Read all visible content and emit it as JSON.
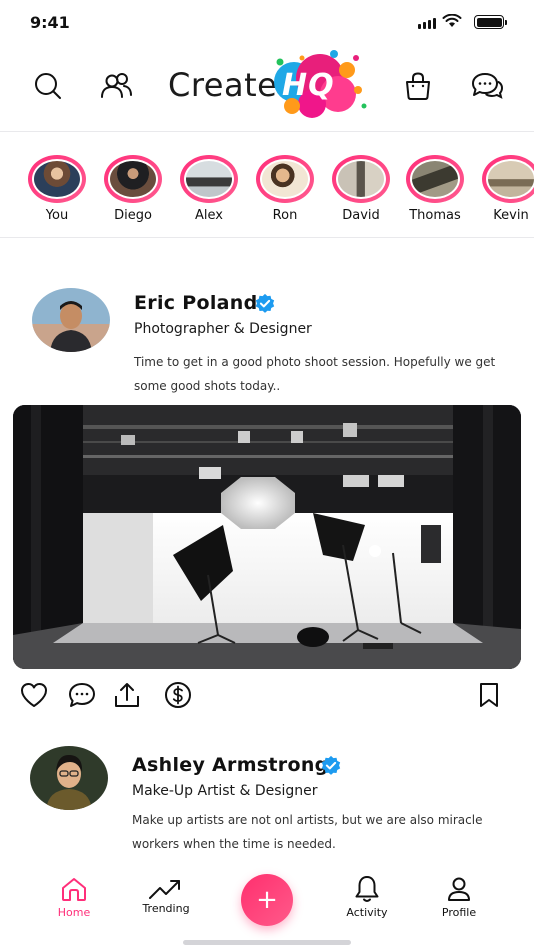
{
  "status_bar": {
    "time": "9:41"
  },
  "header": {
    "logo_text": "Create",
    "logo_badge": "HQ",
    "icons": [
      "search-icon",
      "friends-icon",
      "shopping-bag-icon",
      "chat-bubbles-icon"
    ]
  },
  "stories": [
    {
      "name": "You",
      "color": "#8a6a55"
    },
    {
      "name": "Diego",
      "color": "#3b3535"
    },
    {
      "name": "Alex",
      "color": "#9aa3a8"
    },
    {
      "name": "Ron",
      "color": "#c59a6b"
    },
    {
      "name": "David",
      "color": "#b9b3a6"
    },
    {
      "name": "Thomas",
      "color": "#6f6a5c"
    },
    {
      "name": "Kevin",
      "color": "#a89a86"
    }
  ],
  "posts": [
    {
      "author": "Eric Poland",
      "role": "Photographer & Designer",
      "text_line1": "Time to get in a good photo shoot session. Hopefully we get",
      "text_line2": "some good shots today..",
      "verified": true
    },
    {
      "author": "Ashley Armstrong",
      "role": "Make-Up Artist & Designer",
      "text_line1": "Make up artists are not onl artists, but we are also miracle",
      "text_line2": "workers when the time is needed.",
      "verified": true
    }
  ],
  "tabbar": {
    "home": "Home",
    "trending": "Trending",
    "add": "+",
    "activity": "Activity",
    "profile": "Profile"
  },
  "colors": {
    "accent": "#ff2f7a",
    "verified": "#1d9bf0"
  }
}
